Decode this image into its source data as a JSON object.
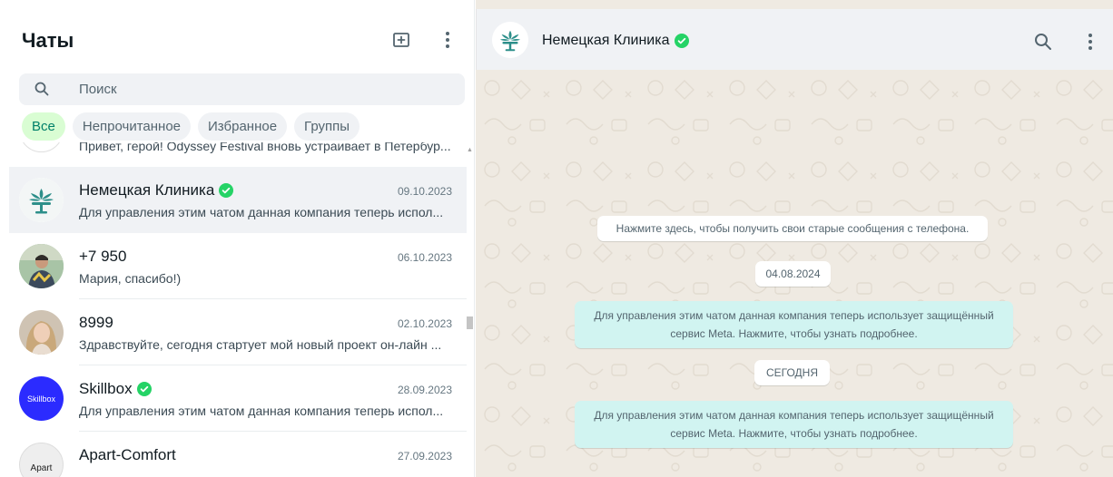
{
  "sidebar": {
    "title": "Чаты",
    "new_chat_icon": "new-chat-icon",
    "menu_icon": "menu-dots-icon"
  },
  "search": {
    "placeholder": "Поиск",
    "value": ""
  },
  "filters": [
    {
      "label": "Все",
      "active": true
    },
    {
      "label": "Непрочитанное",
      "active": false
    },
    {
      "label": "Избранное",
      "active": false
    },
    {
      "label": "Группы",
      "active": false
    }
  ],
  "partial_chat": {
    "preview": "Привет, герой! Odyssey Festival вновь устраивает в Петербур..."
  },
  "chats": [
    {
      "name": "Немецкая Клиника",
      "verified": true,
      "date": "09.10.2023",
      "preview": "Для управления этим чатом данная компания теперь испол...",
      "selected": true
    },
    {
      "name": "+7 950",
      "verified": false,
      "date": "06.10.2023",
      "preview": "Мария, спасибо!)",
      "selected": false
    },
    {
      "name": "8999",
      "verified": false,
      "date": "02.10.2023",
      "preview": "Здравствуйте, сегодня стартует мой новый проект он-лайн ...",
      "selected": false
    },
    {
      "name": "Skillbox",
      "verified": true,
      "date": "28.09.2023",
      "preview": "Для управления этим чатом данная компания теперь испол...",
      "selected": false,
      "avatar_text": "Skillbox"
    },
    {
      "name": "Apart-Comfort",
      "verified": false,
      "date": "27.09.2023",
      "preview": "",
      "selected": false,
      "avatar_text": "Apart"
    }
  ],
  "conversation": {
    "contact_name": "Немецкая Клиника",
    "verified": true,
    "search_icon": "search-icon",
    "menu_icon": "menu-dots-icon",
    "messages": [
      {
        "kind": "system",
        "text": "Нажмите здесь, чтобы получить свои старые сообщения с телефона."
      },
      {
        "kind": "date",
        "text": "04.08.2024"
      },
      {
        "kind": "info",
        "text": "Для управления этим чатом данная компания теперь использует защищённый сервис Meta. Нажмите, чтобы узнать подробнее."
      },
      {
        "kind": "date",
        "text": "СЕГОДНЯ"
      },
      {
        "kind": "info",
        "text": "Для управления этим чатом данная компания теперь использует защищённый сервис Meta. Нажмите, чтобы узнать подробнее."
      }
    ]
  },
  "colors": {
    "accent": "#008069",
    "active_chip_bg": "#d9fdd3",
    "verified": "#25d366",
    "wallpaper": "#efeae2",
    "info_bubble": "#d1f4f1",
    "skillbox_avatar": "#2b2bff"
  }
}
